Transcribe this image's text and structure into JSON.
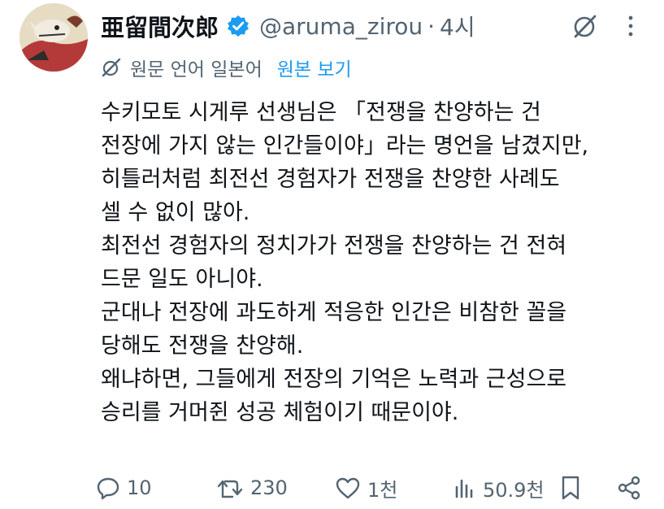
{
  "post": {
    "display_name": "亜留間次郎",
    "handle": "@aruma_zirou",
    "separator": "·",
    "time": "4시",
    "translation": {
      "label": "원문 언어 일본어",
      "show_original": "원본 보기"
    },
    "lines": [
      "수키모토 시게루 선생님은 「전쟁을 찬양하는 건",
      "전장에 가지 않는 인간들이야」라는 명언을 남겼지만,",
      "히틀러처럼 최전선 경험자가 전쟁을 찬양한 사례도",
      "셀 수 없이 많아.",
      "최전선 경험자의 정치가가 전쟁을 찬양하는 건 전혀",
      "드문 일도 아니야.",
      "군대나 전장에 과도하게 적응한 인간은 비참한 꼴을",
      "당해도 전쟁을 찬양해.",
      "왜냐하면, 그들에게 전장의 기억은 노력과 근성으로",
      "승리를 거머쥔 성공 체험이기 때문이야."
    ],
    "stats": {
      "replies": "10",
      "reposts": "230",
      "likes": "1천",
      "views": "50.9천"
    }
  },
  "colors": {
    "text": "#0f1419",
    "secondary": "#536471",
    "link": "#1d9bf0",
    "verified": "#1d9bf0"
  },
  "icons": {
    "verified": "verified-badge-icon",
    "grok": "grok-icon",
    "more": "more-vertical-icon",
    "translate": "translate-icon",
    "reply": "reply-icon",
    "repost": "repost-icon",
    "like": "heart-icon",
    "views": "views-chart-icon",
    "bookmark": "bookmark-icon",
    "share": "share-icon"
  }
}
